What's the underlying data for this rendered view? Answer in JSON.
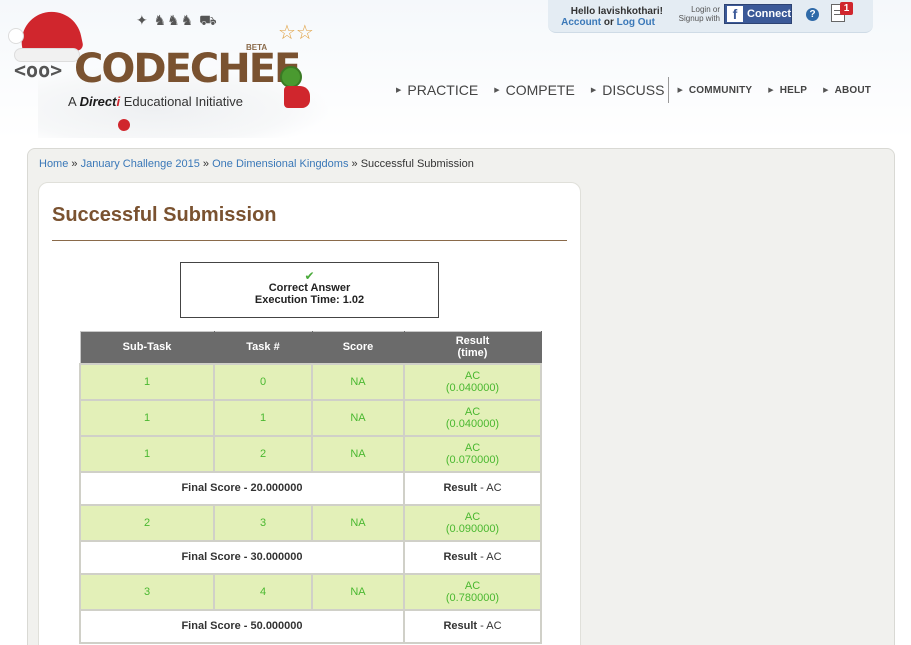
{
  "header": {
    "logo_text": "CODECHEF",
    "logo_beta": "BETA",
    "logo_tag_a": "A",
    "logo_tag_brand": "Direct",
    "logo_tag_brand_i": "i",
    "logo_tag_rest": "Educational Initiative",
    "hello_text": "Hello lavishkothari!",
    "account_label": "Account",
    "or_text": "or",
    "logout_label": "Log Out",
    "login_hint": "Login or Signup with",
    "fb_connect_label": "Connect",
    "notification_count": "1"
  },
  "nav": {
    "main": [
      "PRACTICE",
      "COMPETE",
      "DISCUSS"
    ],
    "secondary": [
      "COMMUNITY",
      "HELP",
      "ABOUT"
    ]
  },
  "breadcrumb": {
    "items": [
      "Home",
      "January Challenge 2015",
      "One Dimensional Kingdoms"
    ],
    "current": "Successful Submission",
    "separator": "»"
  },
  "page_title": "Successful Submission",
  "result_box": {
    "check_glyph": "✔",
    "status": "Correct Answer",
    "exec_label": "Execution Time:",
    "exec_value": "1.02"
  },
  "table": {
    "headers": [
      "Sub-Task",
      "Task #",
      "Score",
      "Result",
      "(time)"
    ],
    "rows": [
      {
        "type": "task",
        "subtask": "1",
        "task": "0",
        "score": "NA",
        "result": "AC",
        "time": "(0.040000)"
      },
      {
        "type": "task",
        "subtask": "1",
        "task": "1",
        "score": "NA",
        "result": "AC",
        "time": "(0.040000)"
      },
      {
        "type": "task",
        "subtask": "1",
        "task": "2",
        "score": "NA",
        "result": "AC",
        "time": "(0.070000)"
      },
      {
        "type": "final",
        "final_score": "Final Score - 20.000000",
        "result_label": "Result",
        "result_value": "- AC"
      },
      {
        "type": "task",
        "subtask": "2",
        "task": "3",
        "score": "NA",
        "result": "AC",
        "time": "(0.090000)"
      },
      {
        "type": "final",
        "final_score": "Final Score - 30.000000",
        "result_label": "Result",
        "result_value": "- AC"
      },
      {
        "type": "task",
        "subtask": "3",
        "task": "4",
        "score": "NA",
        "result": "AC",
        "time": "(0.780000)"
      },
      {
        "type": "final",
        "final_score": "Final Score - 50.000000",
        "result_label": "Result",
        "result_value": "- AC"
      }
    ]
  },
  "colors": {
    "brand_brown": "#7a5230",
    "link_blue": "#3a78b8",
    "task_row_bg": "#e3f0b8",
    "task_text_green": "#4ab830",
    "table_header_bg": "#6b6b6b",
    "facebook_blue": "#3b5998"
  }
}
